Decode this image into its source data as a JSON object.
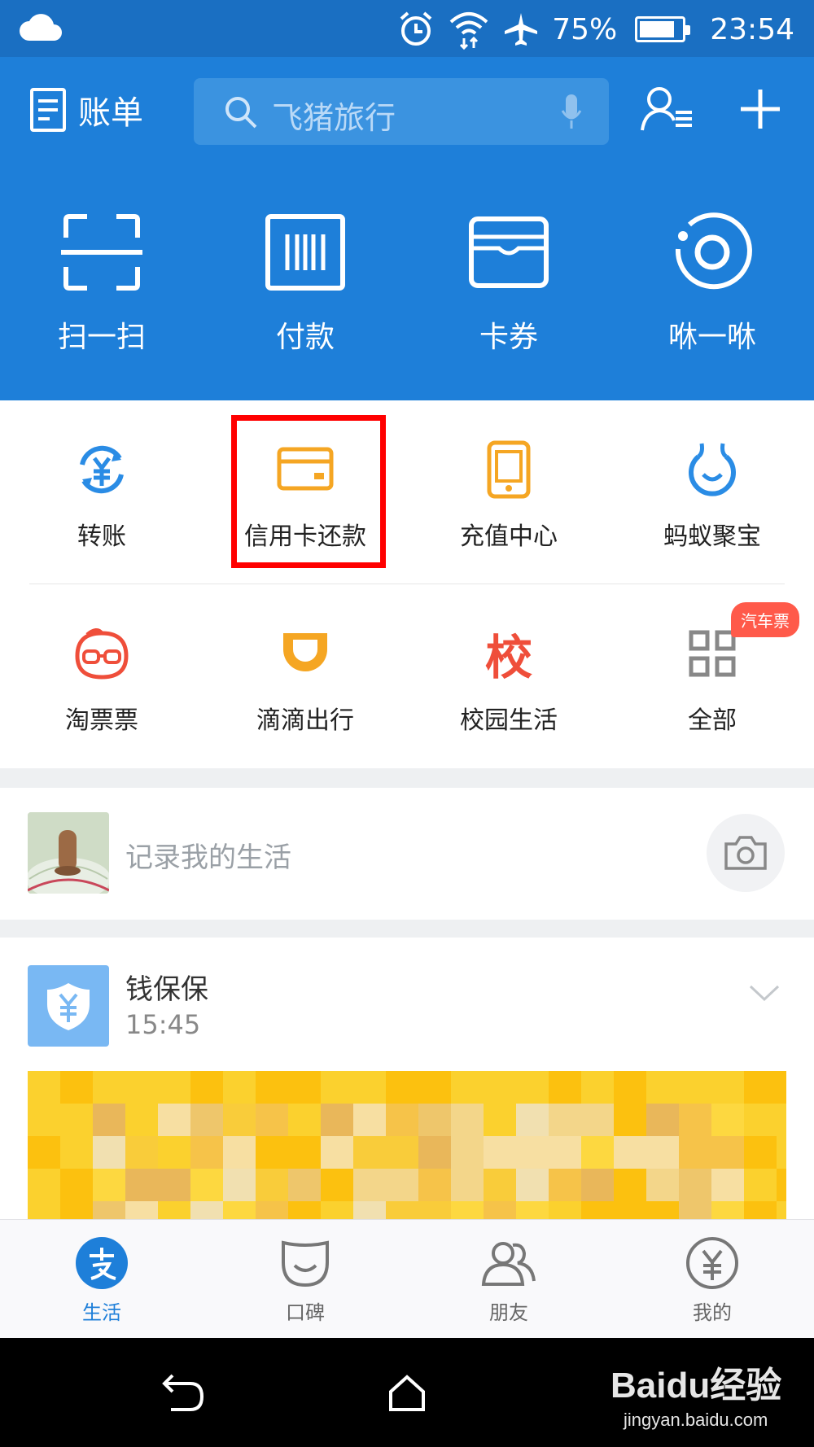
{
  "status_bar": {
    "battery": "75%",
    "battery_level": 0.75,
    "time": "23:54"
  },
  "header": {
    "bill_label": "账单",
    "search_placeholder": "飞猪旅行",
    "big_actions": [
      {
        "label": "扫一扫",
        "icon": "scan-icon"
      },
      {
        "label": "付款",
        "icon": "barcode-icon"
      },
      {
        "label": "卡券",
        "icon": "card-wallet-icon"
      },
      {
        "label": "咻一咻",
        "icon": "xiu-ring-icon"
      }
    ]
  },
  "grid": {
    "row1": [
      {
        "label": "转账",
        "icon": "transfer-icon"
      },
      {
        "label": "信用卡还款",
        "icon": "credit-card-icon",
        "highlighted": true
      },
      {
        "label": "充值中心",
        "icon": "phone-icon"
      },
      {
        "label": "蚂蚁聚宝",
        "icon": "ant-fortune-icon"
      }
    ],
    "row2": [
      {
        "label": "淘票票",
        "icon": "taopiaopiao-icon"
      },
      {
        "label": "滴滴出行",
        "icon": "didi-icon"
      },
      {
        "label": "校园生活",
        "icon": "campus-icon",
        "glyph": "校"
      },
      {
        "label": "全部",
        "icon": "grid-all-icon",
        "badge": "汽车票"
      }
    ]
  },
  "record": {
    "placeholder": "记录我的生活"
  },
  "feed": {
    "title": "钱保保",
    "time": "15:45"
  },
  "tabbar": [
    {
      "label": "生活",
      "icon": "life-icon",
      "active": true
    },
    {
      "label": "口碑",
      "icon": "koubei-icon"
    },
    {
      "label": "朋友",
      "icon": "friends-icon"
    },
    {
      "label": "我的",
      "icon": "mine-yen-icon"
    }
  ],
  "watermark": {
    "brand": "Baidu经验",
    "url": "jingyan.baidu.com"
  },
  "colors": {
    "header_blue": "#1e7fd9",
    "status_blue": "#1a6fc2",
    "highlight_red": "#ff0000",
    "orange": "#f5a623",
    "badge_red": "#ff5a4a"
  }
}
